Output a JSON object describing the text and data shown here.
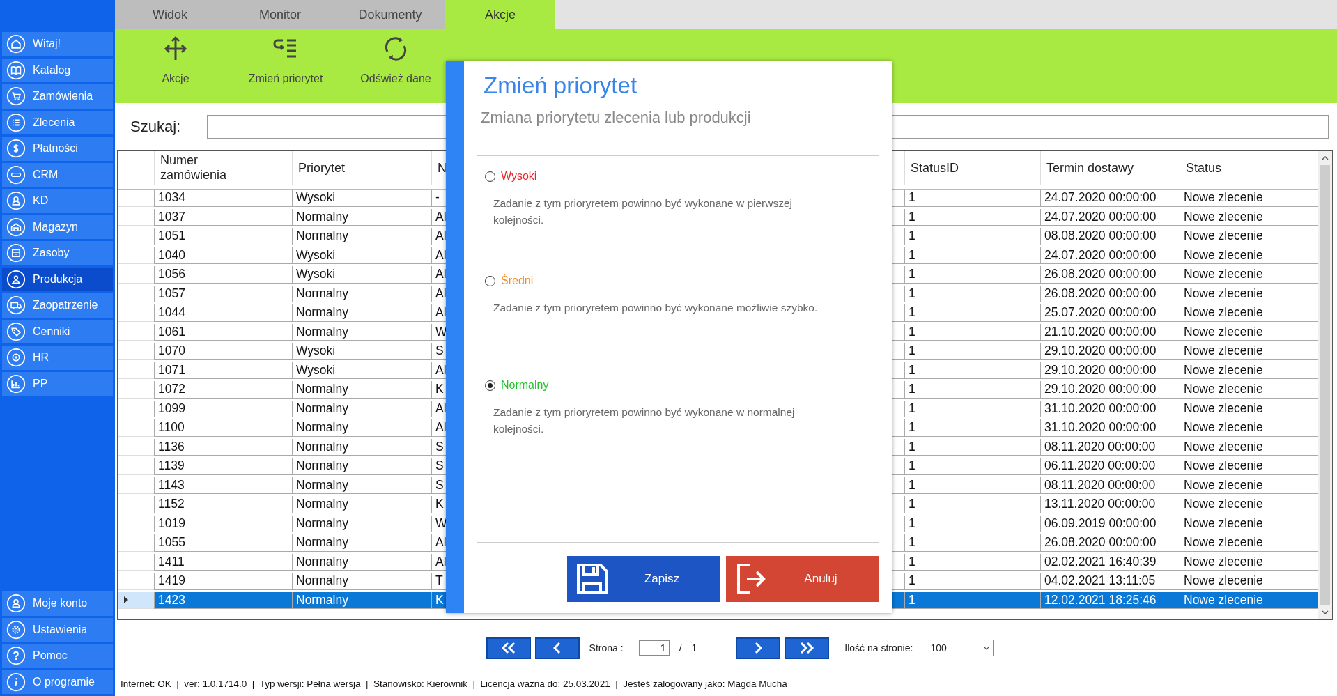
{
  "sidebar": {
    "items": [
      {
        "label": "Witaj!",
        "selected": false
      },
      {
        "label": "Katalog",
        "selected": false
      },
      {
        "label": "Zamówienia",
        "selected": false
      },
      {
        "label": "Zlecenia",
        "selected": false
      },
      {
        "label": "Płatności",
        "selected": false
      },
      {
        "label": "CRM",
        "selected": false
      },
      {
        "label": "KD",
        "selected": false
      },
      {
        "label": "Magazyn",
        "selected": false
      },
      {
        "label": "Zasoby",
        "selected": false
      },
      {
        "label": "Produkcja",
        "selected": true
      },
      {
        "label": "Zaopatrzenie",
        "selected": false
      },
      {
        "label": "Cenniki",
        "selected": false
      },
      {
        "label": "HR",
        "selected": false
      },
      {
        "label": "PP",
        "selected": false
      }
    ],
    "bottom_items": [
      {
        "label": "Moje konto"
      },
      {
        "label": "Ustawienia"
      },
      {
        "label": "Pomoc"
      },
      {
        "label": "O programie"
      }
    ]
  },
  "tabs": [
    {
      "label": "Widok",
      "selected": false
    },
    {
      "label": "Monitor",
      "selected": false
    },
    {
      "label": "Dokumenty",
      "selected": false
    },
    {
      "label": "Akcje",
      "selected": true
    }
  ],
  "ribbon": {
    "buttons": [
      "Akcje",
      "Zmień priorytet",
      "Odśwież dane"
    ]
  },
  "search": {
    "label": "Szukaj:"
  },
  "table": {
    "columns": [
      "Numer zamówienia",
      "Priorytet",
      "N",
      "StatusID",
      "Termin dostawy",
      "Status"
    ],
    "rows": [
      {
        "cells": [
          "1034",
          "Wysoki",
          "-",
          "1",
          "24.07.2020 00:00:00",
          "Nowe zlecenie"
        ],
        "selected": false
      },
      {
        "cells": [
          "1037",
          "Normalny",
          "Al",
          "1",
          "24.07.2020 00:00:00",
          "Nowe zlecenie"
        ],
        "selected": false
      },
      {
        "cells": [
          "1051",
          "Normalny",
          "Al",
          "1",
          "08.08.2020 00:00:00",
          "Nowe zlecenie"
        ],
        "selected": false
      },
      {
        "cells": [
          "1040",
          "Wysoki",
          "Al",
          "1",
          "24.07.2020 00:00:00",
          "Nowe zlecenie"
        ],
        "selected": false
      },
      {
        "cells": [
          "1056",
          "Wysoki",
          "Al",
          "1",
          "26.08.2020 00:00:00",
          "Nowe zlecenie"
        ],
        "selected": false
      },
      {
        "cells": [
          "1057",
          "Normalny",
          "Al",
          "1",
          "26.08.2020 00:00:00",
          "Nowe zlecenie"
        ],
        "selected": false
      },
      {
        "cells": [
          "1044",
          "Normalny",
          "Al",
          "1",
          "25.07.2020 00:00:00",
          "Nowe zlecenie"
        ],
        "selected": false
      },
      {
        "cells": [
          "1061",
          "Normalny",
          "W",
          "1",
          "21.10.2020 00:00:00",
          "Nowe zlecenie"
        ],
        "selected": false
      },
      {
        "cells": [
          "1070",
          "Wysoki",
          "S",
          "1",
          "29.10.2020 00:00:00",
          "Nowe zlecenie"
        ],
        "selected": false
      },
      {
        "cells": [
          "1071",
          "Wysoki",
          "Al",
          "1",
          "29.10.2020 00:00:00",
          "Nowe zlecenie"
        ],
        "selected": false
      },
      {
        "cells": [
          "1072",
          "Normalny",
          "K",
          "1",
          "29.10.2020 00:00:00",
          "Nowe zlecenie"
        ],
        "selected": false
      },
      {
        "cells": [
          "1099",
          "Normalny",
          "Al",
          "1",
          "31.10.2020 00:00:00",
          "Nowe zlecenie"
        ],
        "selected": false
      },
      {
        "cells": [
          "1100",
          "Normalny",
          "Al",
          "1",
          "31.10.2020 00:00:00",
          "Nowe zlecenie"
        ],
        "selected": false
      },
      {
        "cells": [
          "1136",
          "Normalny",
          "S",
          "1",
          "08.11.2020 00:00:00",
          "Nowe zlecenie"
        ],
        "selected": false
      },
      {
        "cells": [
          "1139",
          "Normalny",
          "S",
          "1",
          "06.11.2020 00:00:00",
          "Nowe zlecenie"
        ],
        "selected": false
      },
      {
        "cells": [
          "1143",
          "Normalny",
          "S",
          "1",
          "08.11.2020 00:00:00",
          "Nowe zlecenie"
        ],
        "selected": false
      },
      {
        "cells": [
          "1152",
          "Normalny",
          "K",
          "1",
          "13.11.2020 00:00:00",
          "Nowe zlecenie"
        ],
        "selected": false
      },
      {
        "cells": [
          "1019",
          "Normalny",
          "W",
          "1",
          "06.09.2019 00:00:00",
          "Nowe zlecenie"
        ],
        "selected": false
      },
      {
        "cells": [
          "1055",
          "Normalny",
          "Al",
          "1",
          "26.08.2020 00:00:00",
          "Nowe zlecenie"
        ],
        "selected": false
      },
      {
        "cells": [
          "1411",
          "Normalny",
          "Al",
          "1",
          "02.02.2021 16:40:39",
          "Nowe zlecenie"
        ],
        "selected": false
      },
      {
        "cells": [
          "1419",
          "Normalny",
          "T",
          "1",
          "04.02.2021 13:11:05",
          "Nowe zlecenie"
        ],
        "selected": false
      },
      {
        "cells": [
          "1423",
          "Normalny",
          "K",
          "1",
          "12.02.2021 18:25:46",
          "Nowe zlecenie"
        ],
        "selected": true
      }
    ]
  },
  "pagination": {
    "page_label": "Strona :",
    "page": "1",
    "separator": "/",
    "total": "1",
    "per_page_label": "Ilość na stronie:",
    "per_page": "100"
  },
  "status_bar": "Internet: OK  |  ver: 1.0.1714.0  |  Typ wersji: Pełna wersja  |  Stanowisko: Kierownik  |  Licencja ważna do: 25.03.2021  |  Jesteś zalogowany jako: Magda Mucha",
  "dialog": {
    "title": "Zmień priorytet",
    "subtitle": "Zmiana priorytetu zlecenia lub produkcji",
    "options": [
      {
        "label": "Wysoki",
        "color": "#e8262a",
        "description": "Zadanie z tym prioryretem powinno być wykonane w pierwszej kolejności.",
        "selected": false
      },
      {
        "label": "Średni",
        "color": "#f08a1c",
        "description": "Zadanie z tym prioryretem powinno być wykonane możliwie szybko.",
        "selected": false
      },
      {
        "label": "Normalny",
        "color": "#22c02a",
        "description": "Zadanie z tym prioryretem powinno być wykonane w normalnej kolejności.",
        "selected": true
      }
    ],
    "buttons": [
      {
        "label": "Zapisz",
        "kind": "save"
      },
      {
        "label": "Anuluj",
        "kind": "cancel"
      }
    ]
  }
}
